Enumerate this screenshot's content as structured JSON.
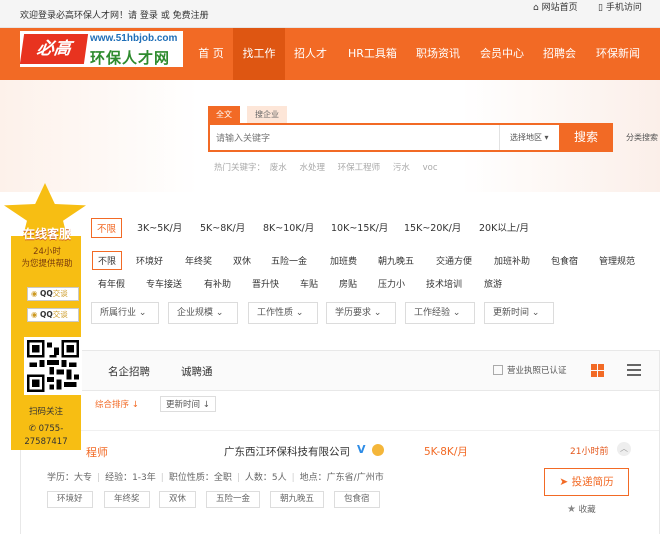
{
  "topbar": {
    "welcome_prefix": "欢迎登录必高环保人才网！请",
    "login": "登录",
    "or": "或",
    "register": "免费注册",
    "site_home": "网站首页",
    "mobile": "手机访问"
  },
  "logo": {
    "badge": "必高",
    "url": "www.51hbjob.com",
    "name": "环保人才网"
  },
  "nav": [
    "首 页",
    "找工作",
    "招人才",
    "HR工具箱",
    "职场资讯",
    "会员中心",
    "招聘会",
    "环保新闻"
  ],
  "search": {
    "tab_full": "全文",
    "tab_company": "搜企业",
    "placeholder": "请输入关键字",
    "region": "选择地区",
    "button": "搜索",
    "classify": "分类搜索",
    "hot_label": "热门关键字：",
    "hot": [
      "废水",
      "水处理",
      "环保工程师",
      "污水",
      "voc"
    ]
  },
  "salary_filter": [
    "不限",
    "3K~5K/月",
    "5K~8K/月",
    "8K~10K/月",
    "10K~15K/月",
    "15K~20K/月",
    "20K以上/月"
  ],
  "benefits_row1": [
    "不限",
    "环境好",
    "年终奖",
    "双休",
    "五险一金",
    "加班费",
    "朝九晚五",
    "交通方便",
    "加班补助",
    "包食宿",
    "管理规范"
  ],
  "benefits_row2": [
    "有年假",
    "专车接送",
    "有补助",
    "晋升快",
    "车贴",
    "房贴",
    "压力小",
    "技术培训",
    "旅游"
  ],
  "dropdowns": [
    "所属行业",
    "企业规模",
    "工作性质",
    "学历要求",
    "工作经验",
    "更新时间"
  ],
  "tabs": [
    "名企招聘",
    "诚聘通"
  ],
  "license_label": "营业执照已认证",
  "sort": {
    "composite": "综合排序",
    "update": "更新时间"
  },
  "job": {
    "title": "程师",
    "company": "广东西江环保科技有限公司",
    "salary": "5K-8K/月",
    "time": "21小时前",
    "education": "学历：大专",
    "experience": "经验：1-3年",
    "nature": "职位性质：全职",
    "headcount": "人数：5人",
    "location": "地点：广东省/广州市",
    "tags": [
      "环境好",
      "年终奖",
      "双休",
      "五险一金",
      "朝九晚五",
      "包食宿"
    ],
    "apply": "投递简历",
    "favorite": "收藏"
  },
  "kefu": {
    "title": "在线客服",
    "hours": "24小时",
    "service": "为您提供帮助",
    "qq_label": "交谈",
    "qq_prefix": "QQ",
    "scan": "扫码关注",
    "phone1": "0755-",
    "phone2": "27587417"
  },
  "colors": {
    "brand": "#f26a25",
    "nav_active": "#de5612",
    "kefu": "#f7be13"
  }
}
